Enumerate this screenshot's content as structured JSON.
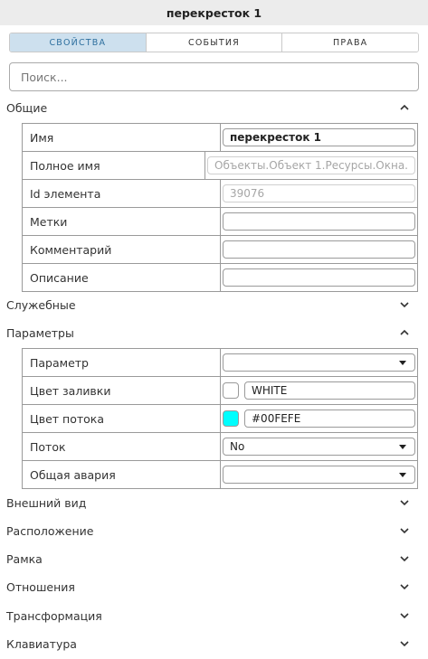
{
  "window": {
    "title": "перекресток 1"
  },
  "tabs": [
    {
      "label": "СВОЙСТВА",
      "active": true
    },
    {
      "label": "СОБЫТИЯ",
      "active": false
    },
    {
      "label": "ПРАВА",
      "active": false
    }
  ],
  "search": {
    "placeholder": "Поиск..."
  },
  "sections": {
    "general": {
      "title": "Общие",
      "expanded": true,
      "rows": {
        "name": {
          "label": "Имя",
          "value": "перекресток 1"
        },
        "full_name": {
          "label": "Полное имя",
          "value": "Объекты.Объект 1.Ресурсы.Окна."
        },
        "element_id": {
          "label": "Id элемента",
          "value": "39076"
        },
        "tags": {
          "label": "Метки",
          "value": ""
        },
        "comment": {
          "label": "Комментарий",
          "value": ""
        },
        "description": {
          "label": "Описание",
          "value": ""
        }
      }
    },
    "service": {
      "title": "Служебные",
      "expanded": false
    },
    "parameters": {
      "title": "Параметры",
      "expanded": true,
      "rows": {
        "parameter": {
          "label": "Параметр",
          "value": ""
        },
        "fill_color": {
          "label": "Цвет заливки",
          "value": "WHITE",
          "swatch": "#ffffff"
        },
        "flow_color": {
          "label": "Цвет потока",
          "value": "#00FEFE",
          "swatch": "#00fefe"
        },
        "flow": {
          "label": "Поток",
          "value": "No"
        },
        "general_alarm": {
          "label": "Общая авария",
          "value": ""
        }
      }
    },
    "appearance": {
      "title": "Внешний вид",
      "expanded": false
    },
    "location": {
      "title": "Расположение",
      "expanded": false
    },
    "frame": {
      "title": "Рамка",
      "expanded": false
    },
    "relations": {
      "title": "Отношения",
      "expanded": false
    },
    "transform": {
      "title": "Трансформация",
      "expanded": false
    },
    "keyboard": {
      "title": "Клавиатура",
      "expanded": false
    }
  },
  "icons": {
    "expanded": "chevron-up-icon",
    "collapsed": "chevron-down-icon",
    "dropdown": "caret-down-icon"
  }
}
